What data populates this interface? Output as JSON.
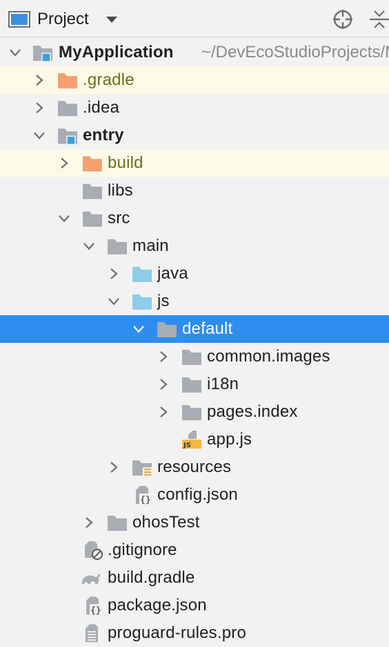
{
  "header": {
    "title": "Project",
    "view_icon": "project-view-icon",
    "dropdown_icon": "chevron-down-icon",
    "locate_icon": "crosshair-icon",
    "collapse_icon": "collapse-all-icon"
  },
  "colors": {
    "selection": "#2f8cf0",
    "excluded_bg": "#fcfae6",
    "folder_gray": "#a8adb3",
    "folder_orange": "#f4a073",
    "folder_blue": "#8dcde9",
    "module_badge": "#3aa2e0"
  },
  "tree": {
    "root_path": "~/DevEcoStudioProjects/MyApplication",
    "items": [
      {
        "label": "MyApplication",
        "icon": "module-folder-icon",
        "chevron": "down"
      },
      {
        "label": ".gradle",
        "icon": "excluded-folder-icon",
        "chevron": "right"
      },
      {
        "label": ".idea",
        "icon": "folder-icon",
        "chevron": "right"
      },
      {
        "label": "entry",
        "icon": "module-folder-icon",
        "chevron": "down"
      },
      {
        "label": "build",
        "icon": "excluded-folder-icon",
        "chevron": "right"
      },
      {
        "label": "libs",
        "icon": "folder-icon",
        "chevron": "none"
      },
      {
        "label": "src",
        "icon": "folder-icon",
        "chevron": "down"
      },
      {
        "label": "main",
        "icon": "folder-icon",
        "chevron": "down"
      },
      {
        "label": "java",
        "icon": "source-folder-icon",
        "chevron": "right"
      },
      {
        "label": "js",
        "icon": "source-folder-icon",
        "chevron": "down"
      },
      {
        "label": "default",
        "icon": "folder-icon",
        "chevron": "down"
      },
      {
        "label": "common.images",
        "icon": "folder-icon",
        "chevron": "right"
      },
      {
        "label": "i18n",
        "icon": "folder-icon",
        "chevron": "right"
      },
      {
        "label": "pages.index",
        "icon": "folder-icon",
        "chevron": "right"
      },
      {
        "label": "app.js",
        "icon": "js-file-icon",
        "chevron": "none"
      },
      {
        "label": "resources",
        "icon": "resources-folder-icon",
        "chevron": "right"
      },
      {
        "label": "config.json",
        "icon": "json-file-icon",
        "chevron": "none"
      },
      {
        "label": "ohosTest",
        "icon": "folder-icon",
        "chevron": "right"
      },
      {
        "label": ".gitignore",
        "icon": "ignored-file-icon",
        "chevron": "none"
      },
      {
        "label": "build.gradle",
        "icon": "gradle-file-icon",
        "chevron": "none"
      },
      {
        "label": "package.json",
        "icon": "json-file-icon",
        "chevron": "none"
      },
      {
        "label": "proguard-rules.pro",
        "icon": "text-file-icon",
        "chevron": "none"
      }
    ]
  }
}
